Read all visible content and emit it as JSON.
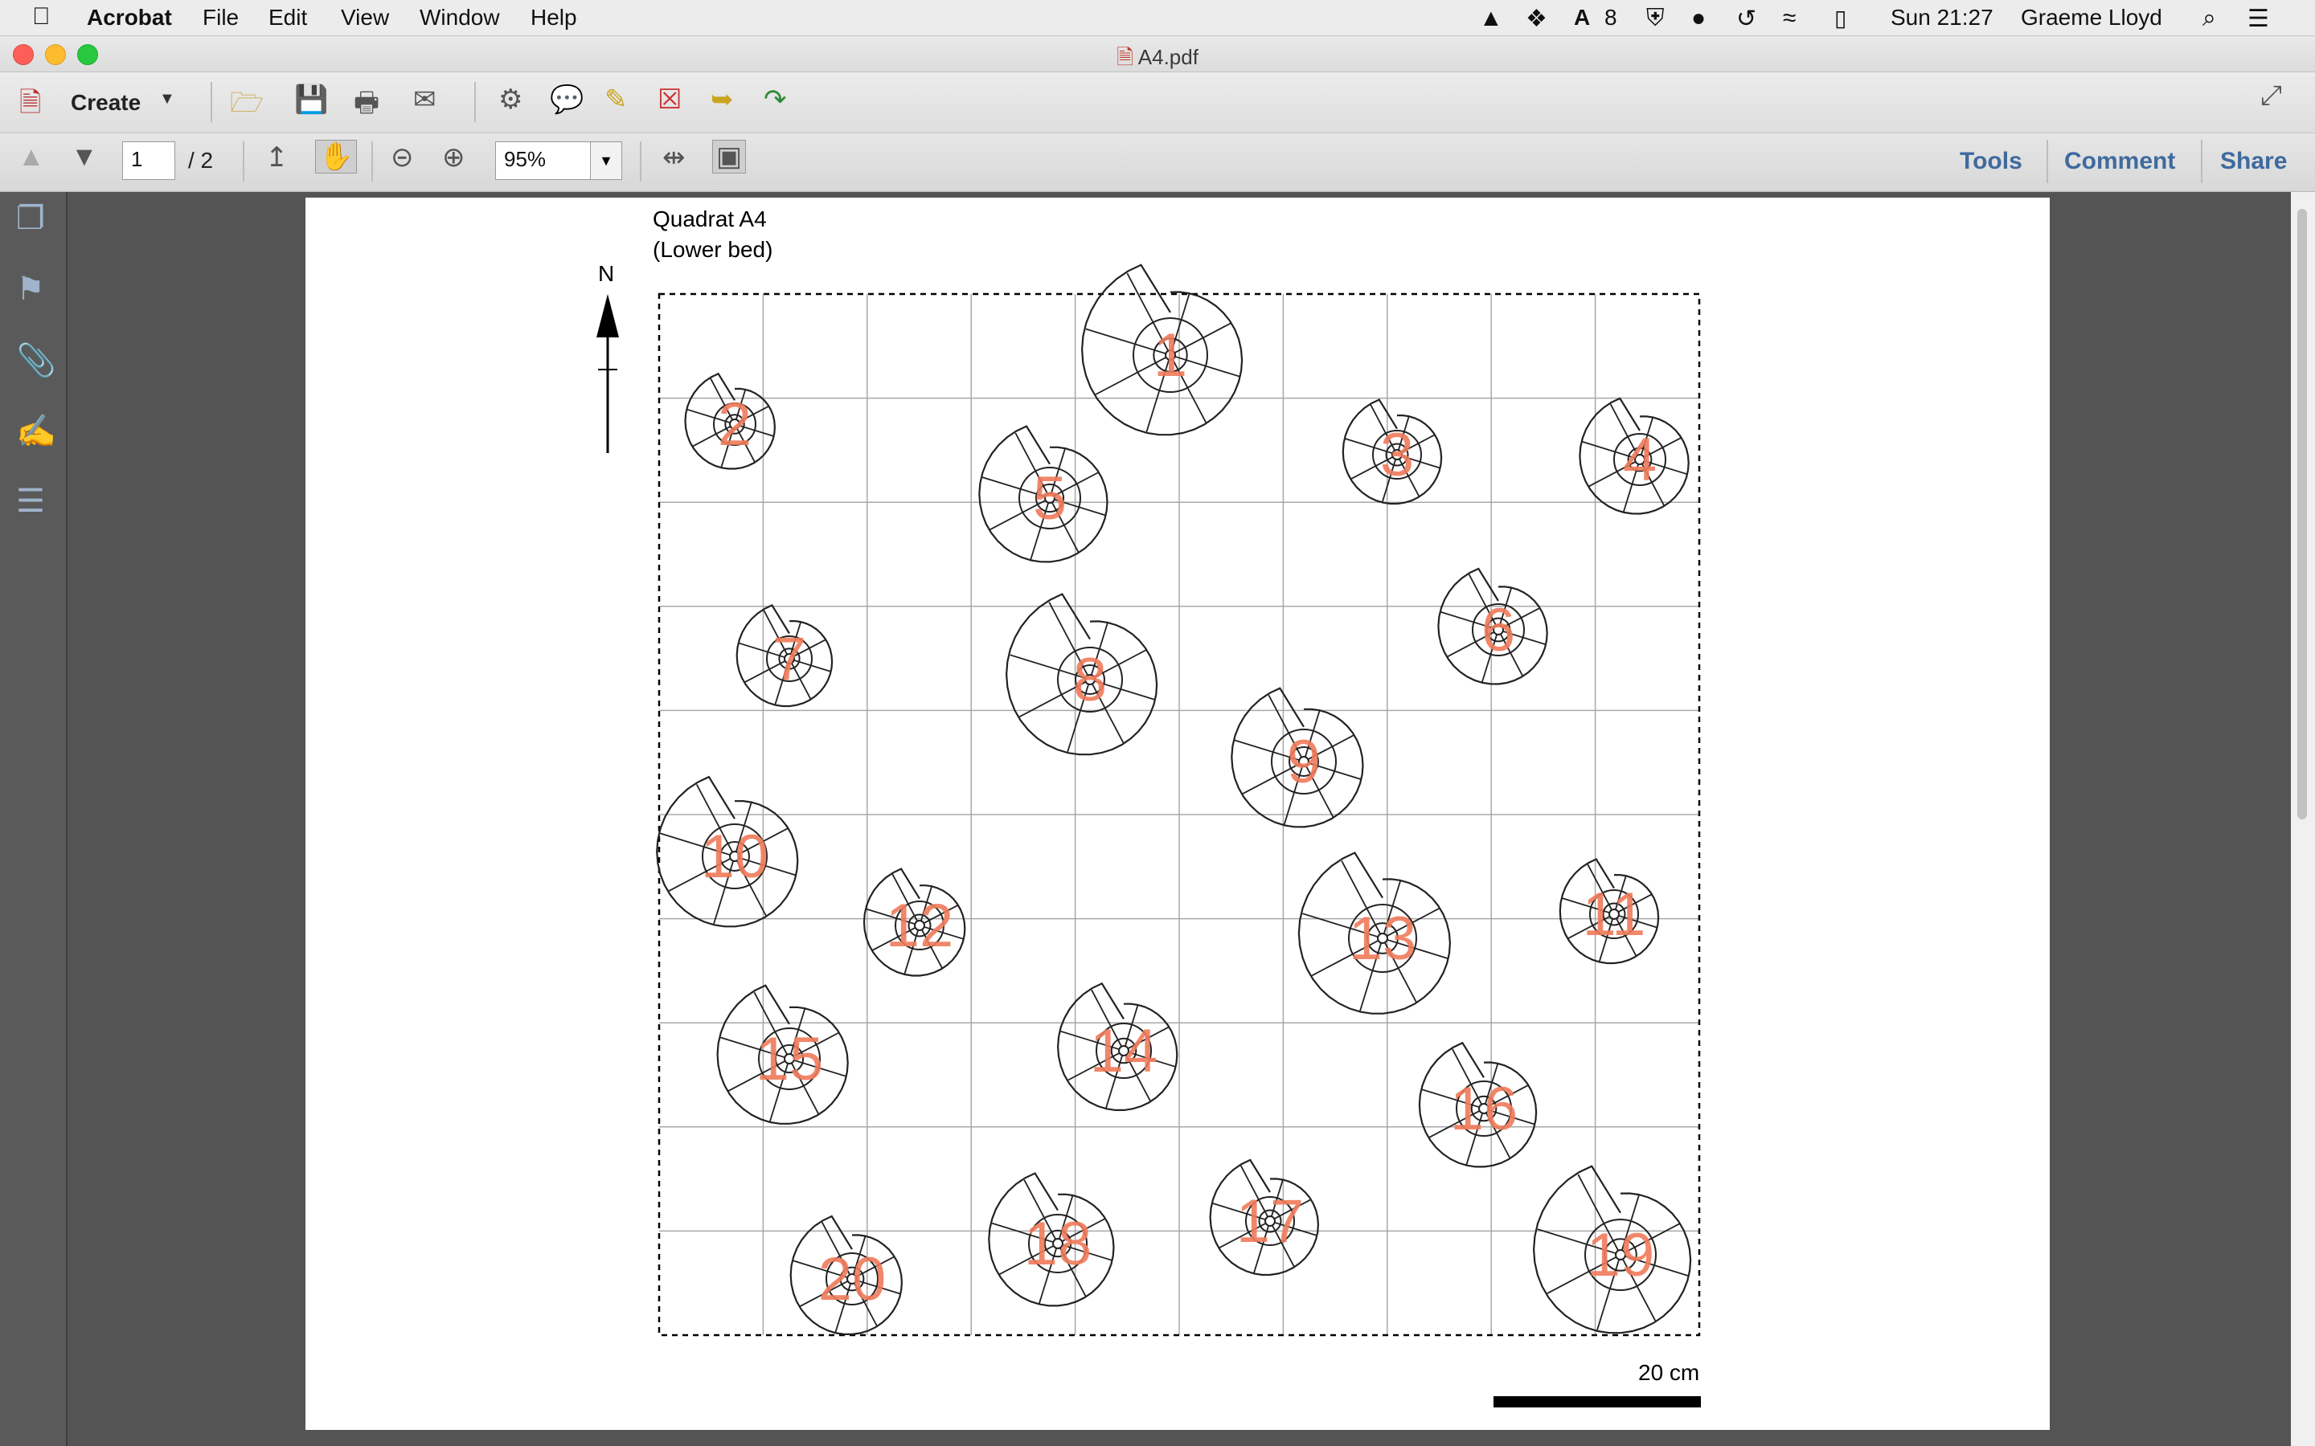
{
  "menubar": {
    "app": "Acrobat",
    "items": [
      "File",
      "Edit",
      "View",
      "Window",
      "Help"
    ],
    "status_badge": "8",
    "clock": "Sun 21:27",
    "user": "Graeme Lloyd"
  },
  "window": {
    "title": "A4.pdf"
  },
  "toolbar": {
    "create_label": "Create",
    "page_current": "1",
    "page_total": "/ 2",
    "zoom": "95%",
    "tools_label": "Tools",
    "comment_label": "Comment",
    "share_label": "Share"
  },
  "document": {
    "title_line1": "Quadrat A4",
    "title_line2": "(Lower bed)",
    "north_label": "N",
    "scale_label": "20 cm",
    "plants": [
      "1",
      "2",
      "3",
      "4",
      "5",
      "6",
      "7",
      "8",
      "9",
      "10",
      "11",
      "12",
      "13",
      "14",
      "15",
      "16",
      "17",
      "18",
      "19",
      "20"
    ]
  },
  "colors": {
    "accent_link": "#3f6a9e",
    "plant_label": "#f07a5a",
    "grid_line": "#a8a8a8"
  }
}
